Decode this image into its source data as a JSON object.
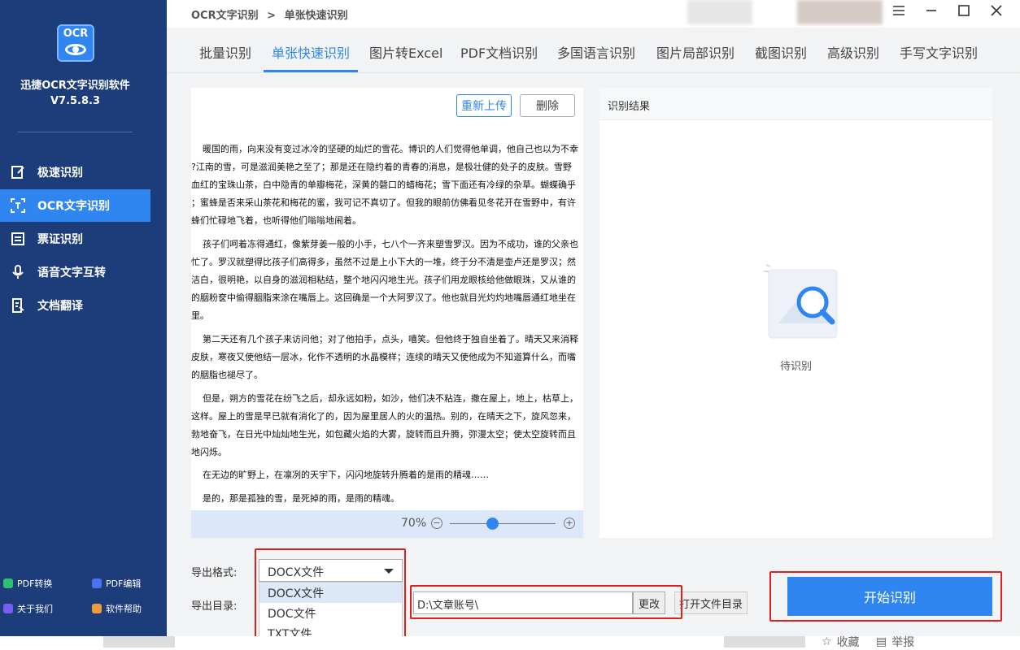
{
  "app": {
    "name": "迅捷OCR文字识别软件",
    "version": "V7.5.8.3",
    "logo_text": "OCR"
  },
  "sidebar": {
    "items": [
      {
        "label": "极速识别",
        "icon": "lightning-edit-icon"
      },
      {
        "label": "OCR文字识别",
        "icon": "scan-text-icon",
        "active": true
      },
      {
        "label": "票证识别",
        "icon": "receipt-icon"
      },
      {
        "label": "语音文字互转",
        "icon": "microphone-icon"
      },
      {
        "label": "文档翻译",
        "icon": "translate-doc-icon"
      }
    ],
    "footer": [
      {
        "label": "PDF转换",
        "icon": "pdf-convert-icon",
        "color": "#2fbf71"
      },
      {
        "label": "PDF编辑",
        "icon": "pdf-edit-icon",
        "color": "#4b73f0"
      },
      {
        "label": "关于我们",
        "icon": "info-icon",
        "color": "#7b5cf0"
      },
      {
        "label": "软件帮助",
        "icon": "help-icon",
        "color": "#f09a3a"
      }
    ]
  },
  "header": {
    "breadcrumb": [
      "OCR文字识别",
      "单张快速识别"
    ],
    "breadcrumb_sep": ">"
  },
  "tabs": [
    {
      "label": "批量识别"
    },
    {
      "label": "单张快速识别",
      "active": true
    },
    {
      "label": "图片转Excel"
    },
    {
      "label": "PDF文档识别"
    },
    {
      "label": "多国语言识别"
    },
    {
      "label": "图片局部识别"
    },
    {
      "label": "截图识别"
    },
    {
      "label": "高级识别"
    },
    {
      "label": "手写文字识别"
    }
  ],
  "doc_panel": {
    "reupload_label": "重新上传",
    "delete_label": "删除",
    "lines": [
      "暖国的雨，向来没有变过冰冷的坚硬的灿烂的雪花。博识的人们觉得他单调，他自己也以为不幸",
      "?江南的雪，可是滋润美艳之至了；那是还在隐约着的青春的消息，是极壮健的处子的皮肤。雪野",
      "血红的宝珠山茶，白中隐青的单瓣梅花，深黄的磬口的蜡梅花；雪下面还有冷绿的杂草。蝴蝶确乎",
      "；蜜蜂是否来采山茶花和梅花的蜜，我可记不真切了。但我的眼前仿佛看见冬花开在雪野中，有许",
      "蜂们忙碌地飞着，也听得他们嗡嗡地闹着。",
      "孩子们呵着冻得通红，像紫芽姜一般的小手，七八个一齐来塑雪罗汉。因为不成功，谁的父亲也",
      "忙了。罗汉就塑得比孩子们高得多，虽然不过是上小下大的一堆，终于分不清是壶卢还是罗汉；然",
      "洁白，很明艳，以自身的滋润相粘结，整个地闪闪地生光。孩子们用龙眼核给他做眼珠，又从谁的",
      "的胭粉奁中偷得胭脂来涂在嘴唇上。这回确是一个大阿罗汉了。他也就目光灼灼地嘴唇通红地坐在",
      "里。",
      "第二天还有几个孩子来访问他；对了他拍手，点头，嘻笑。但他终于独自坐着了。晴天又来消释",
      "皮肤，寒夜又使他结一层冰，化作不透明的水晶模样；连续的晴天又使他成为不知道算什么，而嘴",
      "的胭脂也褪尽了。",
      "但是，朔方的雪花在纷飞之后，却永远如粉，如沙，他们决不粘连，撒在屋上，地上，枯草上，",
      "这样。屋上的雪是早已就有消化了的，因为屋里居人的火的温热。别的，在晴天之下，旋风忽来，",
      "勃地奋飞，在日光中灿灿地生光，如包藏火焰的大雾，旋转而且升腾，弥漫太空；使太空旋转而且",
      "地闪烁。",
      "在无边的旷野上，在凛冽的天宇下，闪闪地旋转升腾着的是雨的精魂……",
      "是的，那是孤独的雪，是死掉的雨，是雨的精魂。"
    ],
    "zoom": "70%",
    "zoom_level": 0.4
  },
  "result_panel": {
    "title": "识别结果",
    "empty_text": "待识别"
  },
  "export": {
    "format_label": "导出格式:",
    "format_value": "DOCX文件",
    "format_options": [
      "DOCX文件",
      "DOC文件",
      "TXT文件"
    ],
    "dir_label": "导出目录:",
    "dir_value": "D:\\文章账号\\",
    "change_label": "更改",
    "open_dir_label": "打开文件目录"
  },
  "start_button": "开始识别",
  "footer": {
    "favorite": "收藏",
    "report": "举报"
  },
  "colors": {
    "sidebar_bg": "#1d3c7a",
    "accent": "#2f86f0",
    "highlight_border": "#e02020"
  }
}
